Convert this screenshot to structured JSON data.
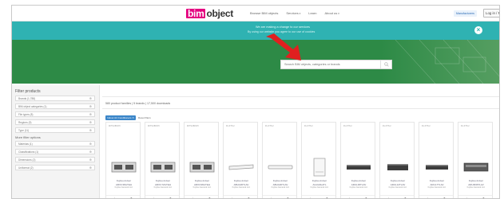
{
  "header": {
    "logo_part1": "bim",
    "logo_part2": "object",
    "nav": [
      {
        "label": "Browse BIM objects",
        "has_menu": false
      },
      {
        "label": "Services",
        "has_menu": true
      },
      {
        "label": "Learn",
        "has_menu": false
      },
      {
        "label": "About us",
        "has_menu": true
      }
    ],
    "store_button": "Manufacturers",
    "login_button": "Log in / Register"
  },
  "banner": {
    "title": "We are making a change to our services",
    "subtitle": "By using our website you agree to our use of cookies",
    "close_icon": "close-icon"
  },
  "hero": {
    "search_placeholder": "Search BIM objects, categories or brands",
    "search_icon": "search-icon",
    "arrow_color": "#e0201f"
  },
  "sidebar": {
    "title": "Filter products",
    "filters": [
      "Brands (1,788)",
      "BIM object categories (1)",
      "File types (8)",
      "Regions (9)",
      "Type (11)"
    ],
    "more_title": "More filter options",
    "more_filters": [
      "Materials (1)",
      "Classifications (1)",
      "Dimensions (2)",
      "Uniformat (2)"
    ]
  },
  "results": {
    "text": "580 product families  |  5 brands  |  17,500 downloads",
    "chip": "Indoor Air Conditioners",
    "reset": "Reset filters"
  },
  "products": [
    {
      "brand": "MITSUBISHI",
      "name": "Fujitsu-Indoor",
      "model": "ARXC36GTEH",
      "sub": "Fujitsu General Ltd.",
      "icon": "ducted-unit-icon"
    },
    {
      "brand": "MITSUBISHI",
      "name": "Fujitsu-Indoor",
      "model": "ARXC72GTEH",
      "sub": "Fujitsu General Ltd.",
      "icon": "ducted-unit-icon"
    },
    {
      "brand": "MITSUBISHI",
      "name": "Fujitsu-Indoor",
      "model": "ARXC96GTEH",
      "sub": "Fujitsu General Ltd.",
      "icon": "ducted-unit-icon"
    },
    {
      "brand": "FUJITSU",
      "name": "Fujitsu-Indoor",
      "model": "ABUA36TLAV",
      "sub": "Fujitsu General Ltd.",
      "icon": "ceiling-unit-icon"
    },
    {
      "brand": "FUJITSU",
      "name": "Fujitsu-Indoor",
      "model": "ABUA30TLAV",
      "sub": "Fujitsu General Ltd.",
      "icon": "wall-unit-icon"
    },
    {
      "brand": "FUJITSU",
      "name": "Fujitsu-Indoor",
      "model": "AGUA9LATL",
      "sub": "Fujitsu General Ltd.",
      "icon": "floor-unit-icon"
    },
    {
      "brand": "FUJITSU",
      "name": "Fujitsu-Indoor",
      "model": "ARUL36TLAV",
      "sub": "Fujitsu General Ltd.",
      "icon": "slim-duct-icon"
    },
    {
      "brand": "FUJITSU",
      "name": "Fujitsu-Indoor",
      "model": "ARUL12TLAV",
      "sub": "Fujitsu General Ltd.",
      "icon": "slim-duct-icon"
    },
    {
      "brand": "FUJITSU",
      "name": "Fujitsu-Indoor",
      "model": "ARUL7TLAV",
      "sub": "Fujitsu General Ltd.",
      "icon": "slim-duct-icon"
    },
    {
      "brand": "FUJITSU",
      "name": "Fujitsu-Indoor",
      "model": "ARUM36TLAV",
      "sub": "Fujitsu General Ltd.",
      "icon": "ducted-unit-icon"
    }
  ],
  "colors": {
    "banner": "#2fb2b2",
    "hero": "#2d8a46",
    "logo_accent": "#e4007f",
    "chip": "#3b86c9"
  }
}
